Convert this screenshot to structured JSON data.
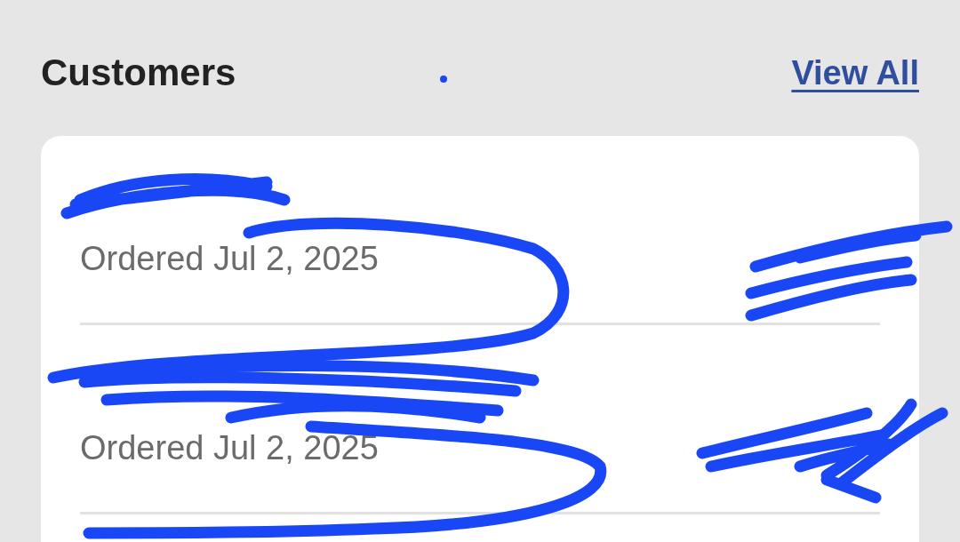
{
  "header": {
    "title": "Customers",
    "link": "View All"
  },
  "customers": [
    {
      "order": "Ordered Jul 2, 2025"
    },
    {
      "order": "Ordered Jul 2, 2025"
    }
  ]
}
